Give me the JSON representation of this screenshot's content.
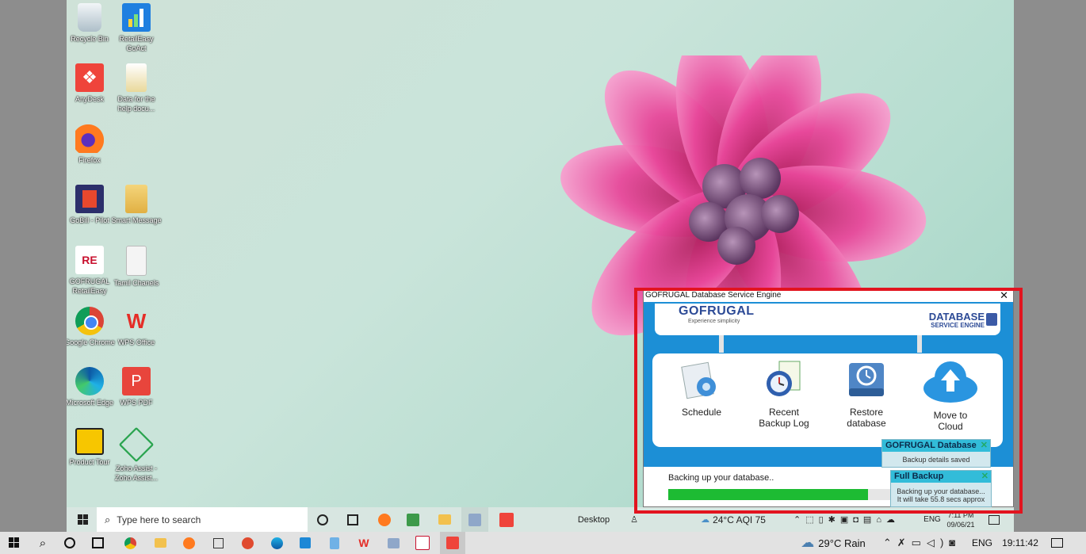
{
  "desktop_icons": [
    {
      "label": "Recycle Bin"
    },
    {
      "label": "RetailEasy GoAct"
    },
    {
      "label": "AnyDesk"
    },
    {
      "label": "Data for the help docu..."
    },
    {
      "label": "Firefox"
    },
    {
      "label": "GoBill - Pilot"
    },
    {
      "label": "Smart Message"
    },
    {
      "label": "GOFRUGAL RetailEasy"
    },
    {
      "label": "Tamil Chanels"
    },
    {
      "label": "Google Chrome"
    },
    {
      "label": "WPS Office"
    },
    {
      "label": "Microsoft Edge"
    },
    {
      "label": "WPS PDF"
    },
    {
      "label": "Product Tour"
    },
    {
      "label": "Zoho Assist - Zoho Assist..."
    }
  ],
  "gofrugal_window": {
    "title": "GOFRUGAL Database Service Engine",
    "logo_text": "GOFRUGAL",
    "logo_tagline": "Experience simplicity",
    "product_line1": "DATABASE",
    "product_line2": "SERVICE ENGINE",
    "tiles": [
      {
        "label": "Schedule"
      },
      {
        "label": "Recent Backup Log"
      },
      {
        "label": "Restore database"
      },
      {
        "label": "Move to Cloud"
      }
    ],
    "progress_text": "Backing up your database..",
    "progress_fraction": 0.9
  },
  "toasts": {
    "first": {
      "title": "GOFRUGAL Database",
      "message": "Backup details saved"
    },
    "second": {
      "title": "Full Backup",
      "line1": "Backing up your database...",
      "line2": "It will take 55.8 secs approx"
    }
  },
  "inner_taskbar": {
    "search_placeholder": "Type here to search",
    "desktop_label": "Desktop",
    "weather": "24°C  AQI 75",
    "language": "ENG",
    "time": "7:11 PM",
    "date": "09/06/21"
  },
  "host_taskbar": {
    "weather": "29°C  Rain",
    "language": "ENG",
    "time": "19:11:42"
  },
  "colors": {
    "accent_blue": "#1c8fd6",
    "progress_green": "#1dbb33",
    "highlight_red": "#e2141f"
  }
}
